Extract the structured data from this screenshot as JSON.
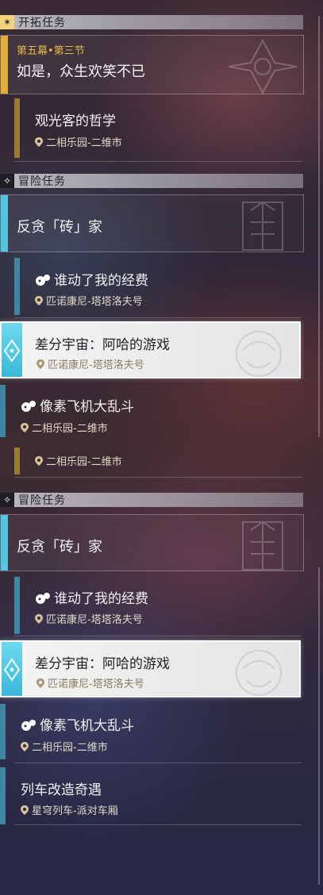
{
  "colors": {
    "gold": "#c99a2e",
    "blue": "#3f86a3",
    "cyan": "#4fc7e3",
    "location_text": "#e2d8c8"
  },
  "trailblaze": {
    "header": "开拓任务",
    "icon": "trailblaze-star-icon",
    "main_quest": {
      "chapter": "第五幕•第三节",
      "title": "如是，众生欢笑不已"
    },
    "sub": {
      "title": "观光客的哲学",
      "location": "二相乐园-二维市"
    }
  },
  "adventure_1": {
    "header": "冒险任务",
    "icon": "adventure-diamond-icon",
    "featured": {
      "title": "反贪「砖」家"
    },
    "items": [
      {
        "title": "谁动了我的经费",
        "location": "匹诺康尼-塔塔洛夫号"
      },
      {
        "title": "差分宇宙：阿哈的游戏",
        "location": "匹诺康尼-塔塔洛夫号"
      },
      {
        "title": "像素飞机大乱斗",
        "location": "二相乐园-二维市"
      },
      {
        "title": "",
        "location": "二相乐园-二维市"
      }
    ]
  },
  "adventure_2": {
    "header": "冒险任务",
    "icon": "adventure-diamond-icon",
    "featured": {
      "title": "反贪「砖」家"
    },
    "items": [
      {
        "title": "谁动了我的经费",
        "location": "匹诺康尼-塔塔洛夫号"
      },
      {
        "title": "差分宇宙：阿哈的游戏",
        "location": "匹诺康尼-塔塔洛夫号"
      },
      {
        "title": "像素飞机大乱斗",
        "location": "二相乐园-二维市"
      },
      {
        "title": "列车改造奇遇",
        "location": "星穹列车-派对车厢"
      }
    ]
  }
}
